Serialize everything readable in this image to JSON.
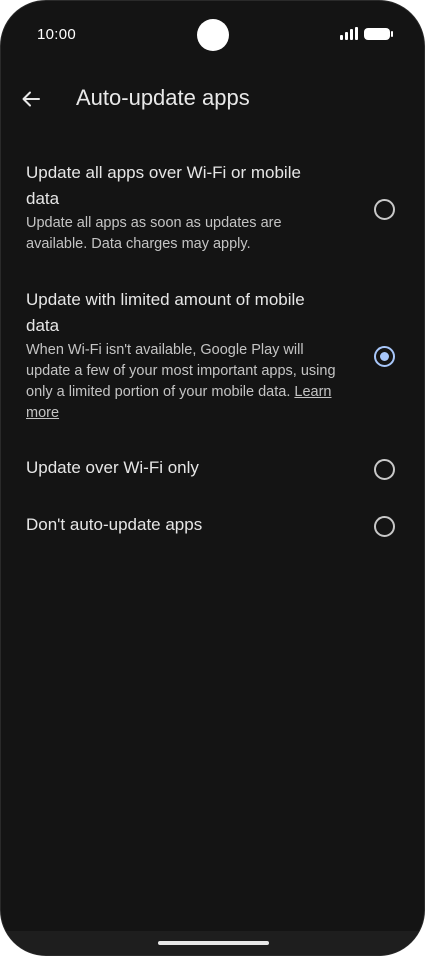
{
  "status_bar": {
    "time": "10:00"
  },
  "header": {
    "title": "Auto-update apps"
  },
  "options": [
    {
      "title": "Update all apps over Wi-Fi or mobile data",
      "description": "Update all apps as soon as updates are available. Data charges may apply.",
      "selected": false
    },
    {
      "title": "Update with limited amount of mobile data",
      "description": "When Wi-Fi isn't available, Google Play will update a few of your most important apps, using only a limited portion of your mobile data.",
      "link": "Learn more",
      "selected": true
    },
    {
      "title": "Update over Wi-Fi only",
      "selected": false
    },
    {
      "title": "Don't auto-update apps",
      "selected": false
    }
  ],
  "colors": {
    "background": "#141414",
    "accent": "#a8c7fa",
    "text": "#e6e6e6",
    "secondary_text": "#c4c4c4"
  }
}
